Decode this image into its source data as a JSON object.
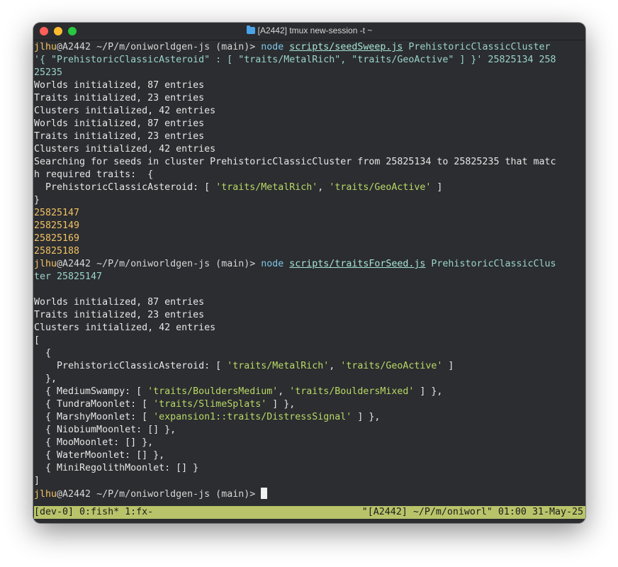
{
  "window": {
    "title": "[A2442] tmux new-session -t ~",
    "folder_icon": "folder-icon"
  },
  "prompt": {
    "user": "jlhu",
    "host": "@A2442",
    "path": " ~/P/m/oniworldgen-js (main)> "
  },
  "lines": [
    [
      {
        "c": "u",
        "t": "jlhu"
      },
      {
        "c": "path",
        "t": "@A2442 ~/P/m/oniworldgen-js (main)> "
      },
      {
        "c": "cmd",
        "t": "node "
      },
      {
        "c": "arg",
        "t": "scripts/seedSweep.js"
      },
      {
        "c": "str",
        "t": " PrehistoricClassicCluster"
      }
    ],
    [
      {
        "c": "str",
        "t": "'{ \"PrehistoricClassicAsteroid\" : [ \"traits/MetalRich\", \"traits/GeoActive\" ] }' 25825134 258"
      }
    ],
    [
      {
        "c": "str",
        "t": "25235"
      }
    ],
    [
      {
        "c": "",
        "t": "Worlds initialized, 87 entries"
      }
    ],
    [
      {
        "c": "",
        "t": "Traits initialized, 23 entries"
      }
    ],
    [
      {
        "c": "",
        "t": "Clusters initialized, 42 entries"
      }
    ],
    [
      {
        "c": "",
        "t": "Worlds initialized, 87 entries"
      }
    ],
    [
      {
        "c": "",
        "t": "Traits initialized, 23 entries"
      }
    ],
    [
      {
        "c": "",
        "t": "Clusters initialized, 42 entries"
      }
    ],
    [
      {
        "c": "",
        "t": "Searching for seeds in cluster PrehistoricClassicCluster from 25825134 to 25825235 that matc"
      }
    ],
    [
      {
        "c": "",
        "t": "h required traits:  {"
      }
    ],
    [
      {
        "c": "",
        "t": "  PrehistoricClassicAsteroid: [ "
      },
      {
        "c": "tstr",
        "t": "'traits/MetalRich'"
      },
      {
        "c": "",
        "t": ", "
      },
      {
        "c": "tstr",
        "t": "'traits/GeoActive'"
      },
      {
        "c": "",
        "t": " ]"
      }
    ],
    [
      {
        "c": "",
        "t": "}"
      }
    ],
    [
      {
        "c": "num",
        "t": "25825147"
      }
    ],
    [
      {
        "c": "num",
        "t": "25825149"
      }
    ],
    [
      {
        "c": "num",
        "t": "25825169"
      }
    ],
    [
      {
        "c": "num",
        "t": "25825188"
      }
    ],
    [
      {
        "c": "u",
        "t": "jlhu"
      },
      {
        "c": "path",
        "t": "@A2442 ~/P/m/oniworldgen-js (main)> "
      },
      {
        "c": "cmd",
        "t": "node "
      },
      {
        "c": "arg",
        "t": "scripts/traitsForSeed.js"
      },
      {
        "c": "str",
        "t": " PrehistoricClassicClus"
      }
    ],
    [
      {
        "c": "str",
        "t": "ter 25825147"
      }
    ],
    [
      {
        "c": "",
        "t": ""
      }
    ],
    [
      {
        "c": "",
        "t": "Worlds initialized, 87 entries"
      }
    ],
    [
      {
        "c": "",
        "t": "Traits initialized, 23 entries"
      }
    ],
    [
      {
        "c": "",
        "t": "Clusters initialized, 42 entries"
      }
    ],
    [
      {
        "c": "",
        "t": "["
      }
    ],
    [
      {
        "c": "",
        "t": "  {"
      }
    ],
    [
      {
        "c": "",
        "t": "    PrehistoricClassicAsteroid: [ "
      },
      {
        "c": "tstr",
        "t": "'traits/MetalRich'"
      },
      {
        "c": "",
        "t": ", "
      },
      {
        "c": "tstr",
        "t": "'traits/GeoActive'"
      },
      {
        "c": "",
        "t": " ]"
      }
    ],
    [
      {
        "c": "",
        "t": "  },"
      }
    ],
    [
      {
        "c": "",
        "t": "  { MediumSwampy: [ "
      },
      {
        "c": "tstr",
        "t": "'traits/BouldersMedium'"
      },
      {
        "c": "",
        "t": ", "
      },
      {
        "c": "tstr",
        "t": "'traits/BouldersMixed'"
      },
      {
        "c": "",
        "t": " ] },"
      }
    ],
    [
      {
        "c": "",
        "t": "  { TundraMoonlet: [ "
      },
      {
        "c": "tstr",
        "t": "'traits/SlimeSplats'"
      },
      {
        "c": "",
        "t": " ] },"
      }
    ],
    [
      {
        "c": "",
        "t": "  { MarshyMoonlet: [ "
      },
      {
        "c": "tstr",
        "t": "'expansion1::traits/DistressSignal'"
      },
      {
        "c": "",
        "t": " ] },"
      }
    ],
    [
      {
        "c": "",
        "t": "  { NiobiumMoonlet: [] },"
      }
    ],
    [
      {
        "c": "",
        "t": "  { MooMoonlet: [] },"
      }
    ],
    [
      {
        "c": "",
        "t": "  { WaterMoonlet: [] },"
      }
    ],
    [
      {
        "c": "",
        "t": "  { MiniRegolithMoonlet: [] }"
      }
    ],
    [
      {
        "c": "",
        "t": "]"
      }
    ],
    [
      {
        "c": "u",
        "t": "jlhu"
      },
      {
        "c": "path",
        "t": "@A2442 ~/P/m/oniworldgen-js (main)> "
      }
    ]
  ],
  "status": {
    "left": "[dev-0] 0:fish* 1:fx-",
    "right": "\"[A2442] ~/P/m/oniworl\" 01:00 31-May-25"
  },
  "colors": {
    "background": "#2b2d30",
    "prompt_user": "#f5c265",
    "command": "#7fc6e6",
    "string": "#9bd3cb",
    "number": "#f2c264",
    "trait_string": "#b9d865",
    "statusbar": "#b9c46a"
  }
}
